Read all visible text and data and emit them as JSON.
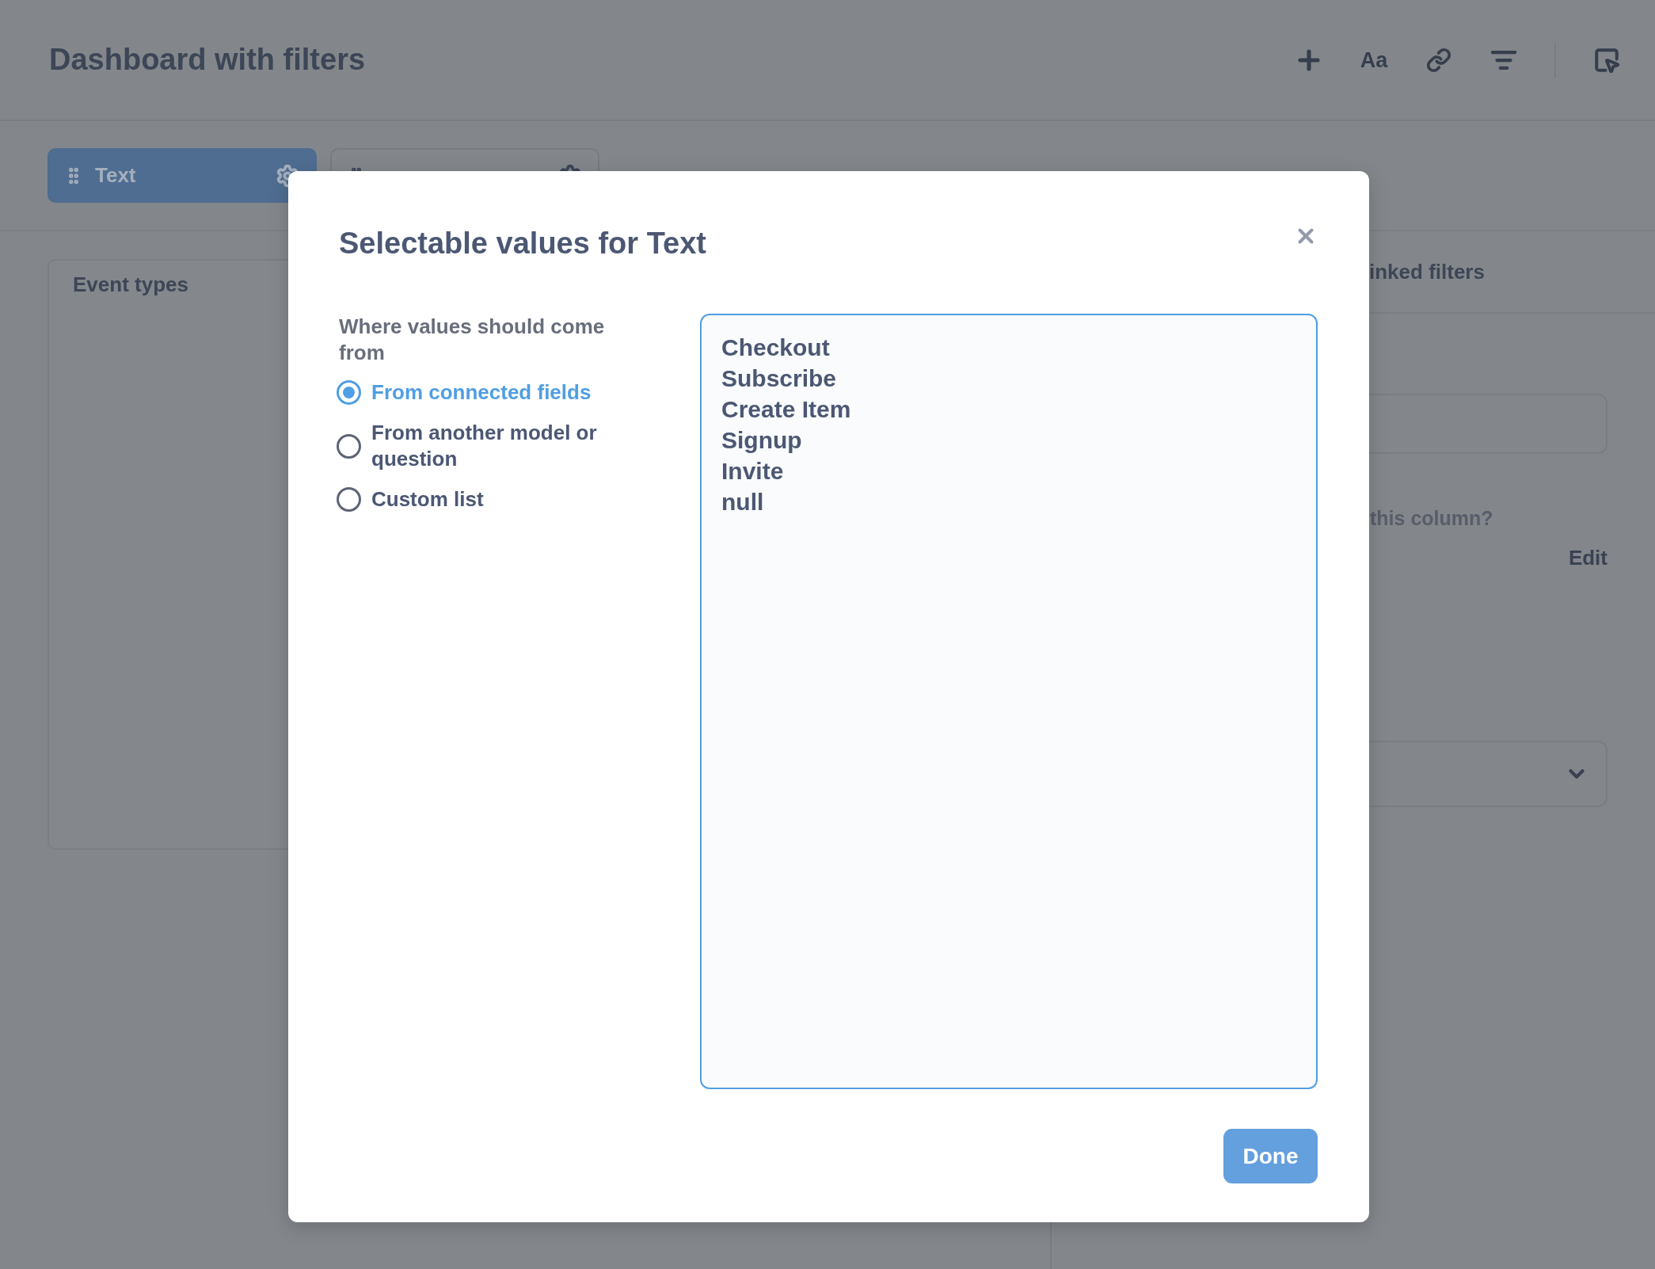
{
  "header": {
    "title": "Dashboard with filters",
    "text_button": "Aa"
  },
  "filter_tabs": [
    {
      "label": "Text",
      "selected": true
    },
    {
      "selected": false
    }
  ],
  "cards": [
    {
      "title": "Event types"
    }
  ],
  "sidebar": {
    "tab": "inked filters",
    "question": "this column?",
    "edit_link": "Edit"
  },
  "modal": {
    "title": "Selectable values for Text",
    "source_label": "Where values should come from",
    "options": [
      {
        "label": "From connected fields",
        "selected": true
      },
      {
        "label": "From another model or question",
        "selected": false
      },
      {
        "label": "Custom list",
        "selected": false
      }
    ],
    "values": [
      "Checkout",
      "Subscribe",
      "Create Item",
      "Signup",
      "Invite",
      "null"
    ],
    "done_button": "Done"
  }
}
